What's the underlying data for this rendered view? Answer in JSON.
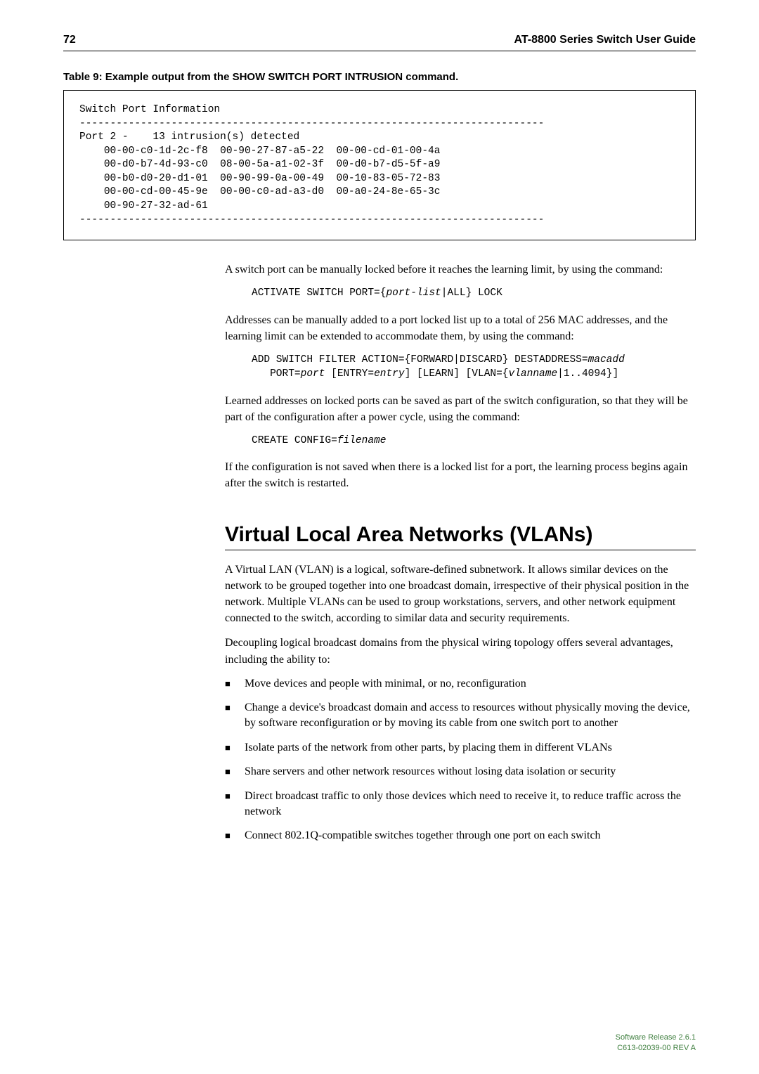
{
  "header": {
    "page_number": "72",
    "title": "AT-8800 Series Switch User Guide"
  },
  "table_title": "Table 9: Example output from the SHOW SWITCH PORT INTRUSION command.",
  "code_box": {
    "line1": "Switch Port Information",
    "dashes1": "----------------------------------------------------------------------------",
    "port_line": "Port 2 -    13 intrusion(s) detected",
    "c1a": "00-00-c0-1d-2c-f8",
    "c1b": "00-90-27-87-a5-22",
    "c1c": "00-00-cd-01-00-4a",
    "c2a": "00-d0-b7-4d-93-c0",
    "c2b": "08-00-5a-a1-02-3f",
    "c2c": "00-d0-b7-d5-5f-a9",
    "c3a": "00-b0-d0-20-d1-01",
    "c3b": "00-90-99-0a-00-49",
    "c3c": "00-10-83-05-72-83",
    "c4a": "00-00-cd-00-45-9e",
    "c4b": "00-00-c0-ad-a3-d0",
    "c4c": "00-a0-24-8e-65-3c",
    "c5a": "00-90-27-32-ad-61",
    "dashes2": "----------------------------------------------------------------------------"
  },
  "body": {
    "p1": "A switch port can be manually locked before it reaches the learning limit, by using the command:",
    "cmd1_pre": "ACTIVATE SWITCH PORT={",
    "cmd1_italic": "port-list",
    "cmd1_post": "|ALL} LOCK",
    "p2": "Addresses can be manually added to a port locked list up to a total of 256 MAC addresses, and the learning limit can be extended to accommodate them, by using the command:",
    "cmd2_a": "ADD SWITCH FILTER ACTION={FORWARD|DISCARD} DESTADDRESS=",
    "cmd2_macadd": "macadd",
    "cmd2_b": "   PORT=",
    "cmd2_port": "port",
    "cmd2_c": " [ENTRY=",
    "cmd2_entry": "entry",
    "cmd2_d": "] [LEARN] [VLAN={",
    "cmd2_vlan": "vlanname",
    "cmd2_e": "|1..4094}]",
    "p3": "Learned addresses on locked ports can be saved as part of the switch configuration, so that they will be part of the configuration after a power cycle, using the command:",
    "cmd3_a": "CREATE CONFIG=",
    "cmd3_filename": "filename",
    "p4": "If the configuration is not saved when there is a locked list for a port, the learning process begins again after the switch is restarted."
  },
  "section": {
    "heading": "Virtual Local Area Networks (VLANs)",
    "p1": "A Virtual LAN (VLAN) is a logical, software-defined subnetwork. It allows similar devices on the network to be grouped together into one broadcast domain, irrespective of their physical position in the network. Multiple VLANs can be used to group workstations, servers, and other network equipment connected to the switch, according to similar data and security requirements.",
    "p2": "Decoupling logical broadcast domains from the physical wiring topology offers several advantages, including the ability to:",
    "bullets": {
      "b1": "Move devices and people with minimal, or no, reconfiguration",
      "b2": "Change a device's broadcast domain and access to resources without physically moving the device, by software reconfiguration or by moving its cable from one switch port to another",
      "b3": "Isolate parts of the network from other parts, by placing them in different VLANs",
      "b4": "Share servers and other network resources without losing data isolation or security",
      "b5": "Direct broadcast traffic to only those devices which need to receive it, to reduce traffic across the network",
      "b6": "Connect 802.1Q-compatible switches together through one port on each switch"
    }
  },
  "footer": {
    "line1": "Software Release 2.6.1",
    "line2": "C613-02039-00 REV A"
  }
}
